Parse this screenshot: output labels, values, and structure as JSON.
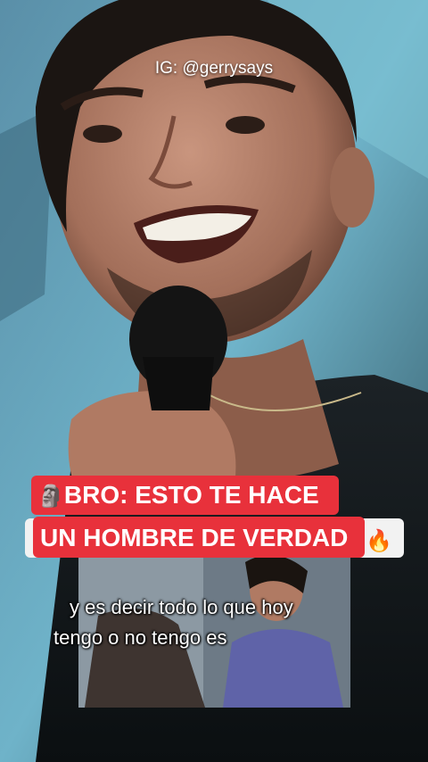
{
  "watermark": {
    "handle": "IG: @gerrysays"
  },
  "banner": {
    "line1_emoji": "🗿",
    "line1": "BRO: ESTO TE HACE",
    "line2": "UN HOMBRE DE VERDAD",
    "line2_emoji": "🔥",
    "highlight_color": "#e8313b"
  },
  "subtitles": {
    "line1": "y es decir todo lo que hoy",
    "line2": "tengo o no tengo es"
  }
}
